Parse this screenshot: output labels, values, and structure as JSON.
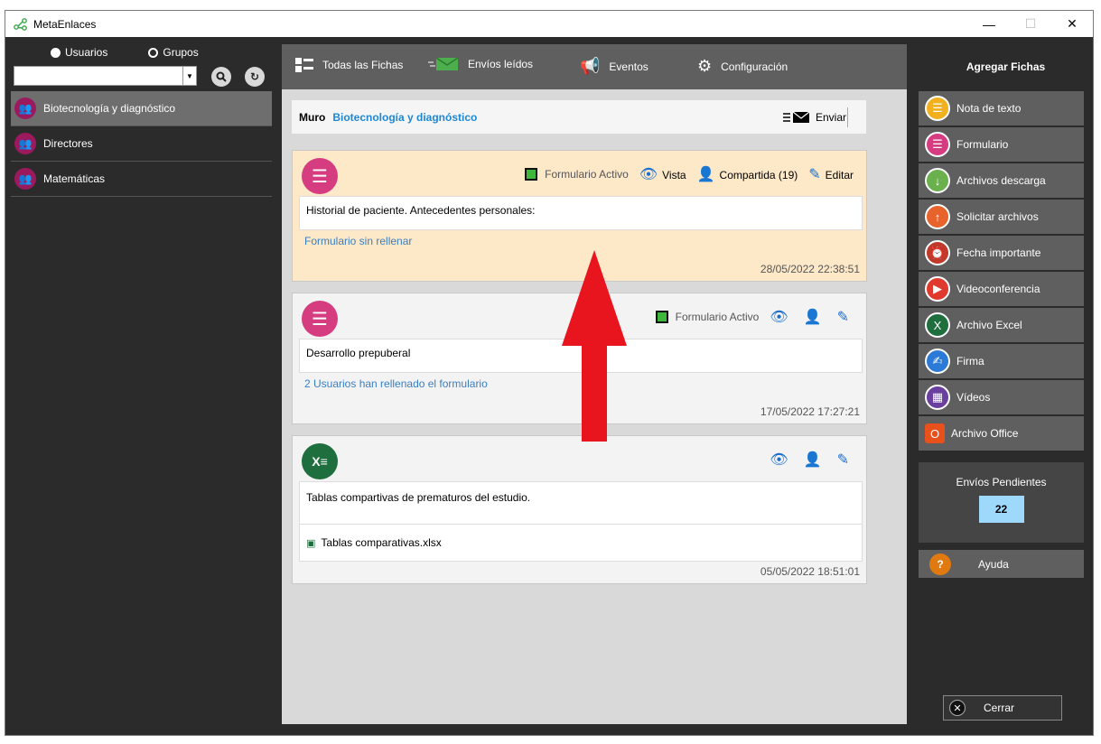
{
  "window": {
    "title": "MetaEnlaces",
    "minimize": "—",
    "maximize": "☐",
    "close": "✕"
  },
  "left": {
    "radio_users": "Usuarios",
    "radio_groups": "Grupos",
    "combo_value": "",
    "groups": [
      {
        "label": "Biotecnología y diagnóstico",
        "selected": true
      },
      {
        "label": "Directores",
        "selected": false
      },
      {
        "label": "Matemáticas",
        "selected": false
      }
    ]
  },
  "nav": {
    "all": "Todas las Fichas",
    "read": "Envíos leídos",
    "events": "Eventos",
    "config": "Configuración"
  },
  "muro": {
    "label": "Muro",
    "group": "Biotecnología y diagnóstico",
    "send": "Enviar"
  },
  "cards": [
    {
      "status": "Formulario Activo",
      "view": "Vista",
      "shared": "Compartida (19)",
      "edit": "Editar",
      "text": "Historial de paciente. Antecedentes personales:",
      "link": "Formulario sin rellenar",
      "date": "28/05/2022 22:38:51"
    },
    {
      "status": "Formulario Activo",
      "text": "Desarrollo prepuberal",
      "link": "2 Usuarios han rellenado el formulario",
      "date": "17/05/2022 17:27:21"
    },
    {
      "text": "Tablas compartivas de prematuros del estudio.",
      "file": "Tablas comparativas.xlsx",
      "date": "05/05/2022 18:51:01"
    }
  ],
  "right": {
    "title": "Agregar Fichas",
    "buttons": [
      {
        "label": "Nota de texto",
        "color": "#f2b01e"
      },
      {
        "label": "Formulario",
        "color": "#d63c80"
      },
      {
        "label": "Archivos descarga",
        "color": "#6ab04c"
      },
      {
        "label": "Solicitar archivos",
        "color": "#e8632b"
      },
      {
        "label": "Fecha importante",
        "color": "#c0392b"
      },
      {
        "label": "Videoconferencia",
        "color": "#e03a2f"
      },
      {
        "label": "Archivo Excel",
        "color": "#1f6e3e"
      },
      {
        "label": "Firma",
        "color": "#2b7bd6"
      },
      {
        "label": "Vídeos",
        "color": "#6a3fa0"
      },
      {
        "label": "Archivo Office",
        "color": "#e8501c"
      }
    ],
    "pending_label": "Envíos Pendientes",
    "pending_count": "22",
    "help": "Ayuda",
    "close": "Cerrar"
  }
}
